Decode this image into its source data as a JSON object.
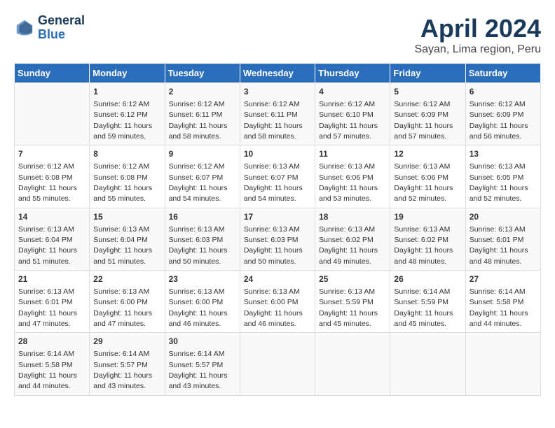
{
  "logo": {
    "line1": "General",
    "line2": "Blue"
  },
  "title": "April 2024",
  "subtitle": "Sayan, Lima region, Peru",
  "days_of_week": [
    "Sunday",
    "Monday",
    "Tuesday",
    "Wednesday",
    "Thursday",
    "Friday",
    "Saturday"
  ],
  "weeks": [
    [
      {
        "day": "",
        "info": ""
      },
      {
        "day": "1",
        "info": "Sunrise: 6:12 AM\nSunset: 6:12 PM\nDaylight: 11 hours\nand 59 minutes."
      },
      {
        "day": "2",
        "info": "Sunrise: 6:12 AM\nSunset: 6:11 PM\nDaylight: 11 hours\nand 58 minutes."
      },
      {
        "day": "3",
        "info": "Sunrise: 6:12 AM\nSunset: 6:11 PM\nDaylight: 11 hours\nand 58 minutes."
      },
      {
        "day": "4",
        "info": "Sunrise: 6:12 AM\nSunset: 6:10 PM\nDaylight: 11 hours\nand 57 minutes."
      },
      {
        "day": "5",
        "info": "Sunrise: 6:12 AM\nSunset: 6:09 PM\nDaylight: 11 hours\nand 57 minutes."
      },
      {
        "day": "6",
        "info": "Sunrise: 6:12 AM\nSunset: 6:09 PM\nDaylight: 11 hours\nand 56 minutes."
      }
    ],
    [
      {
        "day": "7",
        "info": "Sunrise: 6:12 AM\nSunset: 6:08 PM\nDaylight: 11 hours\nand 55 minutes."
      },
      {
        "day": "8",
        "info": "Sunrise: 6:12 AM\nSunset: 6:08 PM\nDaylight: 11 hours\nand 55 minutes."
      },
      {
        "day": "9",
        "info": "Sunrise: 6:12 AM\nSunset: 6:07 PM\nDaylight: 11 hours\nand 54 minutes."
      },
      {
        "day": "10",
        "info": "Sunrise: 6:13 AM\nSunset: 6:07 PM\nDaylight: 11 hours\nand 54 minutes."
      },
      {
        "day": "11",
        "info": "Sunrise: 6:13 AM\nSunset: 6:06 PM\nDaylight: 11 hours\nand 53 minutes."
      },
      {
        "day": "12",
        "info": "Sunrise: 6:13 AM\nSunset: 6:06 PM\nDaylight: 11 hours\nand 52 minutes."
      },
      {
        "day": "13",
        "info": "Sunrise: 6:13 AM\nSunset: 6:05 PM\nDaylight: 11 hours\nand 52 minutes."
      }
    ],
    [
      {
        "day": "14",
        "info": "Sunrise: 6:13 AM\nSunset: 6:04 PM\nDaylight: 11 hours\nand 51 minutes."
      },
      {
        "day": "15",
        "info": "Sunrise: 6:13 AM\nSunset: 6:04 PM\nDaylight: 11 hours\nand 51 minutes."
      },
      {
        "day": "16",
        "info": "Sunrise: 6:13 AM\nSunset: 6:03 PM\nDaylight: 11 hours\nand 50 minutes."
      },
      {
        "day": "17",
        "info": "Sunrise: 6:13 AM\nSunset: 6:03 PM\nDaylight: 11 hours\nand 50 minutes."
      },
      {
        "day": "18",
        "info": "Sunrise: 6:13 AM\nSunset: 6:02 PM\nDaylight: 11 hours\nand 49 minutes."
      },
      {
        "day": "19",
        "info": "Sunrise: 6:13 AM\nSunset: 6:02 PM\nDaylight: 11 hours\nand 48 minutes."
      },
      {
        "day": "20",
        "info": "Sunrise: 6:13 AM\nSunset: 6:01 PM\nDaylight: 11 hours\nand 48 minutes."
      }
    ],
    [
      {
        "day": "21",
        "info": "Sunrise: 6:13 AM\nSunset: 6:01 PM\nDaylight: 11 hours\nand 47 minutes."
      },
      {
        "day": "22",
        "info": "Sunrise: 6:13 AM\nSunset: 6:00 PM\nDaylight: 11 hours\nand 47 minutes."
      },
      {
        "day": "23",
        "info": "Sunrise: 6:13 AM\nSunset: 6:00 PM\nDaylight: 11 hours\nand 46 minutes."
      },
      {
        "day": "24",
        "info": "Sunrise: 6:13 AM\nSunset: 6:00 PM\nDaylight: 11 hours\nand 46 minutes."
      },
      {
        "day": "25",
        "info": "Sunrise: 6:13 AM\nSunset: 5:59 PM\nDaylight: 11 hours\nand 45 minutes."
      },
      {
        "day": "26",
        "info": "Sunrise: 6:14 AM\nSunset: 5:59 PM\nDaylight: 11 hours\nand 45 minutes."
      },
      {
        "day": "27",
        "info": "Sunrise: 6:14 AM\nSunset: 5:58 PM\nDaylight: 11 hours\nand 44 minutes."
      }
    ],
    [
      {
        "day": "28",
        "info": "Sunrise: 6:14 AM\nSunset: 5:58 PM\nDaylight: 11 hours\nand 44 minutes."
      },
      {
        "day": "29",
        "info": "Sunrise: 6:14 AM\nSunset: 5:57 PM\nDaylight: 11 hours\nand 43 minutes."
      },
      {
        "day": "30",
        "info": "Sunrise: 6:14 AM\nSunset: 5:57 PM\nDaylight: 11 hours\nand 43 minutes."
      },
      {
        "day": "",
        "info": ""
      },
      {
        "day": "",
        "info": ""
      },
      {
        "day": "",
        "info": ""
      },
      {
        "day": "",
        "info": ""
      }
    ]
  ]
}
